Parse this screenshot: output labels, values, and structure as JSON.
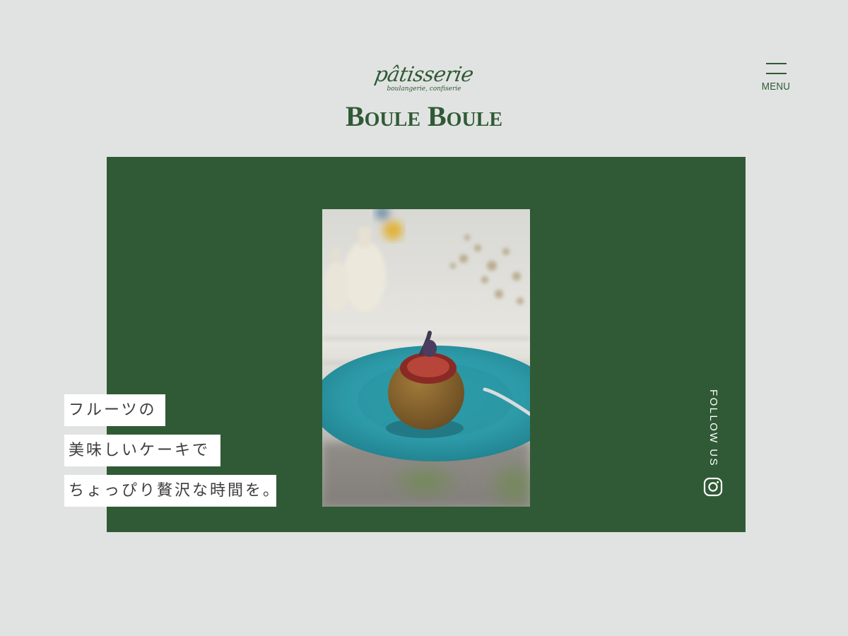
{
  "brand": {
    "script": "pâtisserie",
    "tagline": "boulangerie, confiserie",
    "name": "Boule Boule",
    "color": "#305a35"
  },
  "menu": {
    "label": "MENU",
    "icon": "hamburger-icon"
  },
  "hero": {
    "panel_color": "#305a35",
    "photo_alt": "fig cake on a turquoise plate",
    "catchphrase": [
      "フルーツの",
      "美味しいケーキで",
      "ちょっぴり贅沢な時間を。"
    ]
  },
  "social": {
    "follow_label": "FOLLOW US",
    "instagram_icon": "instagram-icon"
  },
  "colors": {
    "background": "#e1e3e2",
    "accent": "#305a35",
    "on_accent": "#ffffff"
  }
}
